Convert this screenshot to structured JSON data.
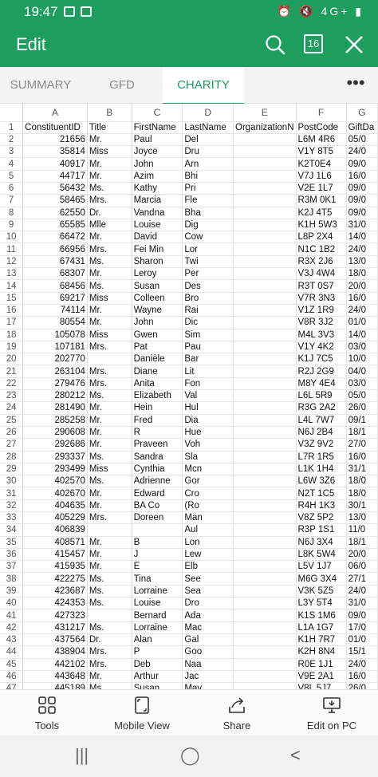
{
  "status": {
    "time": "19:47",
    "right_icons": "⏰ 🔇 4G+ ▮"
  },
  "app": {
    "title": "Edit",
    "sheet_count": "16"
  },
  "tabs": [
    {
      "label": "SUMMARY"
    },
    {
      "label": "GFD"
    },
    {
      "label": "CHARITY"
    }
  ],
  "more_label": "•••",
  "sheet": {
    "columns": [
      "A",
      "B",
      "C",
      "D",
      "E",
      "F",
      "G"
    ],
    "header_row": [
      "ConstituentID",
      "Title",
      "FirstName",
      "LastName",
      "OrganizationN",
      "PostCode",
      "GiftDa"
    ],
    "rows": [
      [
        "21656",
        "Mr.",
        "Paul",
        "Del",
        "",
        "L6M 4R6",
        "05/0"
      ],
      [
        "35814",
        "Miss",
        "Joyce",
        "Dru",
        "",
        "V1Y 8T5",
        "24/0"
      ],
      [
        "40917",
        "Mr.",
        "John",
        "Arn",
        "",
        "K2T0E4",
        "09/0"
      ],
      [
        "44717",
        "Mr.",
        "Azim",
        "Bhi",
        "",
        "V7J 1L6",
        "16/0"
      ],
      [
        "56432",
        "Ms.",
        "Kathy",
        "Pri",
        "",
        "V2E 1L7",
        "09/0"
      ],
      [
        "58465",
        "Mrs.",
        "Marcia",
        "Fle",
        "",
        "R3M 0K1",
        "09/0"
      ],
      [
        "62550",
        "Dr.",
        "Vandna",
        "Bha",
        "",
        "K2J 4T5",
        "09/0"
      ],
      [
        "65585",
        "Mlle",
        "Louise",
        "Dig",
        "",
        "K1H 5W3",
        "31/0"
      ],
      [
        "66472",
        "Mr.",
        "David",
        "Cow",
        "",
        "L8P 2X4",
        "14/0"
      ],
      [
        "66956",
        "Mrs.",
        "Fei Min",
        "Lor",
        "",
        "N1C 1B2",
        "24/0"
      ],
      [
        "67431",
        "Ms.",
        "Sharon",
        "Twi",
        "",
        "R3X 2J6",
        "13/0"
      ],
      [
        "68307",
        "Mr.",
        "Leroy",
        "Per",
        "",
        "V3J 4W4",
        "18/0"
      ],
      [
        "68456",
        "Ms.",
        "Susan",
        "Des",
        "",
        "R3T 0S7",
        "20/0"
      ],
      [
        "69217",
        "Miss",
        "Colleen",
        "Bro",
        "",
        "V7R 3N3",
        "16/0"
      ],
      [
        "74114",
        "Mr.",
        "Wayne",
        "Rai",
        "",
        "V1Z 1R9",
        "24/0"
      ],
      [
        "80554",
        "Mr.",
        "John",
        "Dic",
        "",
        "V8R 3J2",
        "01/0"
      ],
      [
        "105078",
        "Miss",
        "Gwen",
        "Sim",
        "",
        "M4L 3V3",
        "14/0"
      ],
      [
        "107181",
        "Mrs.",
        "Pat",
        "Pau",
        "",
        "V1Y 4K2",
        "03/0"
      ],
      [
        "202770",
        "",
        "Danièle",
        "Bar",
        "",
        "K1J 7C5",
        "10/0"
      ],
      [
        "263104",
        "Mrs.",
        "Diane",
        "Lit",
        "",
        "R2J 2G9",
        "04/0"
      ],
      [
        "279476",
        "Mrs.",
        "Anita",
        "Fon",
        "",
        "M8Y 4E4",
        "03/0"
      ],
      [
        "280212",
        "Ms.",
        "Elizabeth",
        "Val",
        "",
        "L6L 5R9",
        "05/0"
      ],
      [
        "281490",
        "Mr.",
        "Hein",
        "Hul",
        "",
        "R3G 2A2",
        "26/0"
      ],
      [
        "285258",
        "Mr.",
        "Fred",
        "Dia",
        "",
        "L4L 7W7",
        "09/1"
      ],
      [
        "290608",
        "Mr.",
        "R",
        "Hue",
        "",
        "N6J 2B4",
        "18/1"
      ],
      [
        "292686",
        "Mr.",
        "Praveen",
        "Voh",
        "",
        "V3Z 9V2",
        "27/0"
      ],
      [
        "293337",
        "Ms.",
        "Sandra",
        "Sla",
        "",
        "L7R 1R5",
        "16/0"
      ],
      [
        "293499",
        "Miss",
        "Cynthia",
        "Mcn",
        "",
        "L1K 1H4",
        "31/1"
      ],
      [
        "402570",
        "Ms.",
        "Adrienne",
        "Gor",
        "",
        "L6W 3Z6",
        "18/0"
      ],
      [
        "402670",
        "Mr.",
        "Edward",
        "Cro",
        "",
        "N2T 1C5",
        "18/0"
      ],
      [
        "404635",
        "Mr.",
        "BA Co",
        "(Ro",
        "",
        "R4H 1K3",
        "30/1"
      ],
      [
        "405229",
        "Mrs.",
        "Doreen",
        "Man",
        "",
        "V8Z 5P2",
        "13/0"
      ],
      [
        "406839",
        "",
        "",
        "Aul",
        "",
        "R3P 1S1",
        "11/0"
      ],
      [
        "408571",
        "Mr.",
        "B",
        "Lon",
        "",
        "N6J 3X4",
        "18/1"
      ],
      [
        "415457",
        "Mr.",
        "J",
        "Lew",
        "",
        "L8K 5W4",
        "20/0"
      ],
      [
        "415935",
        "Mr.",
        "E",
        "Elb",
        "",
        "L5V 1J7",
        "06/0"
      ],
      [
        "422275",
        "Ms.",
        "Tina",
        "See",
        "",
        "M6G 3X4",
        "27/1"
      ],
      [
        "423687",
        "Ms.",
        "Lorraine",
        "Sea",
        "",
        "V3K 5Z5",
        "24/0"
      ],
      [
        "424353",
        "Ms.",
        "Louise",
        "Dro",
        "",
        "L3Y 5T4",
        "31/0"
      ],
      [
        "427323",
        "",
        "Bernard",
        "Ada",
        "",
        "K1S 1M6",
        "09/0"
      ],
      [
        "431217",
        "Ms.",
        "Lorraine",
        "Mac",
        "",
        "L1A 1G7",
        "17/0"
      ],
      [
        "437564",
        "Dr.",
        "Alan",
        "Gal",
        "",
        "K1H 7R7",
        "01/0"
      ],
      [
        "438904",
        "Mrs.",
        "P",
        "Goo",
        "",
        "K2H 8N4",
        "15/1"
      ],
      [
        "442102",
        "Mrs.",
        "Deb",
        "Naa",
        "",
        "R0E 1J1",
        "24/0"
      ],
      [
        "443648",
        "Mr.",
        "Arthur",
        "Jac",
        "",
        "V9E 2A1",
        "16/0"
      ],
      [
        "445189",
        "Ms.",
        "Susan",
        "May",
        "",
        "V8L 5J7",
        "26/0"
      ]
    ]
  },
  "bottom": [
    {
      "label": "Tools",
      "icon": "tools-icon"
    },
    {
      "label": "Mobile View",
      "icon": "mobile-view-icon"
    },
    {
      "label": "Share",
      "icon": "share-icon"
    },
    {
      "label": "Edit on PC",
      "icon": "edit-on-pc-icon"
    }
  ],
  "nav": {
    "recents": "|||",
    "home": "◯",
    "back": "<"
  },
  "colors": {
    "accent": "#1e9e5e"
  }
}
